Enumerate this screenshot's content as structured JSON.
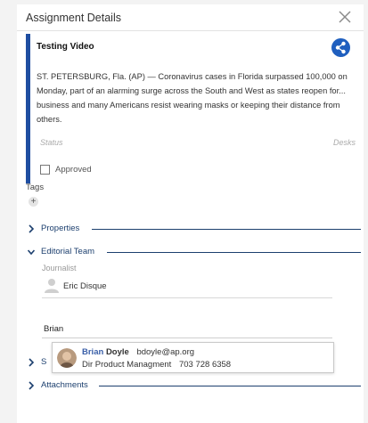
{
  "panel": {
    "title": "Assignment Details"
  },
  "card": {
    "title": "Testing Video",
    "body_line1": "ST. PETERSBURG, Fla. (AP) — Coronavirus cases in Florida surpassed 100,000 on",
    "body_line2": "Monday, part of an alarming surge across the South and West as states reopen for...",
    "body_line3": "business and many Americans resist wearing masks or keeping their distance from",
    "body_line4": "others.",
    "status_label": "Status",
    "desks_label": "Desks",
    "approved_label": "Approved",
    "approved_checked": false
  },
  "tags": {
    "label": "Tags",
    "add_symbol": "+"
  },
  "sections": {
    "properties": "Properties",
    "editorial_team": "Editorial Team",
    "partial_label": "S",
    "attachments": "Attachments"
  },
  "editorial_team": {
    "journalist_label": "Journalist",
    "journalist_name": "Eric Disque",
    "search_value": "Brian"
  },
  "suggestion": {
    "first_name": "Brian",
    "last_name": "Doyle",
    "email": "bdoyle@ap.org",
    "title": "Dir Product Managment",
    "phone": "703 728 6358"
  },
  "colors": {
    "accent_bar": "#1f4ea1",
    "share_button": "#1f5fbf",
    "section_text": "#1c3f6e"
  },
  "icons": {
    "close": "close-icon",
    "share": "share-icon",
    "chevron_right": "chevron-right-icon",
    "chevron_down": "chevron-down-icon",
    "person_placeholder": "person-icon"
  }
}
